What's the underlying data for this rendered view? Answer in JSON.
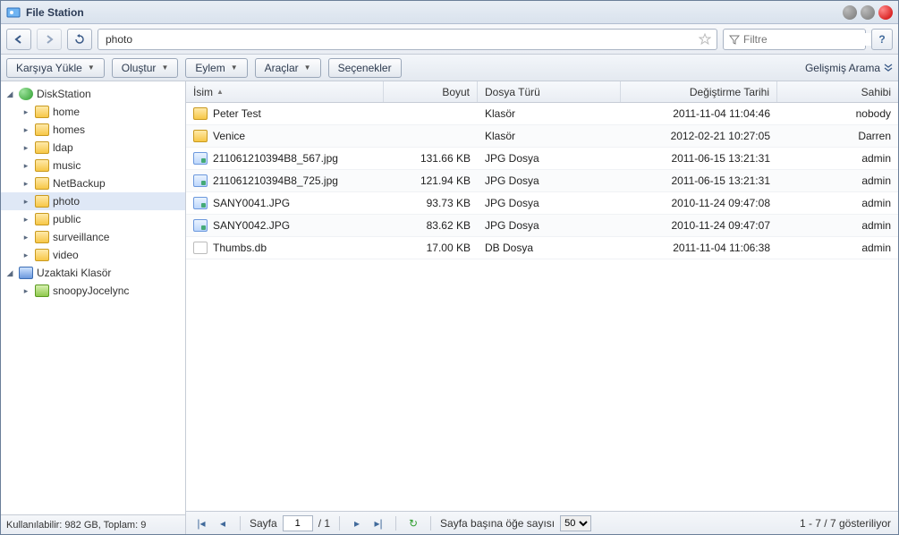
{
  "window": {
    "title": "File Station"
  },
  "nav": {
    "path_value": "photo",
    "filter_placeholder": "Filtre",
    "help_label": "?"
  },
  "toolbar": {
    "upload": "Karşıya Yükle",
    "create": "Oluştur",
    "action": "Eylem",
    "tools": "Araçlar",
    "options": "Seçenekler",
    "advanced_search": "Gelişmiş Arama"
  },
  "sidebar": {
    "root1": "DiskStation",
    "items1": [
      "home",
      "homes",
      "ldap",
      "music",
      "NetBackup",
      "photo",
      "public",
      "surveillance",
      "video"
    ],
    "selected": "photo",
    "root2": "Uzaktaki Klasör",
    "items2": [
      "snoopyJocelync"
    ],
    "status": "Kullanılabilir: 982 GB, Toplam: 9"
  },
  "columns": {
    "name": "İsim",
    "size": "Boyut",
    "type": "Dosya Türü",
    "modified": "Değiştirme Tarihi",
    "owner": "Sahibi"
  },
  "rows": [
    {
      "icon": "folder",
      "name": "Peter Test",
      "size": "",
      "type": "Klasör",
      "date": "2011-11-04 11:04:46",
      "owner": "nobody"
    },
    {
      "icon": "folder",
      "name": "Venice",
      "size": "",
      "type": "Klasör",
      "date": "2012-02-21 10:27:05",
      "owner": "Darren"
    },
    {
      "icon": "jpg",
      "name": "211061210394B8_567.jpg",
      "size": "131.66 KB",
      "type": "JPG Dosya",
      "date": "2011-06-15 13:21:31",
      "owner": "admin"
    },
    {
      "icon": "jpg",
      "name": "211061210394B8_725.jpg",
      "size": "121.94 KB",
      "type": "JPG Dosya",
      "date": "2011-06-15 13:21:31",
      "owner": "admin"
    },
    {
      "icon": "jpg",
      "name": "SANY0041.JPG",
      "size": "93.73 KB",
      "type": "JPG Dosya",
      "date": "2010-11-24 09:47:08",
      "owner": "admin"
    },
    {
      "icon": "jpg",
      "name": "SANY0042.JPG",
      "size": "83.62 KB",
      "type": "JPG Dosya",
      "date": "2010-11-24 09:47:07",
      "owner": "admin"
    },
    {
      "icon": "db",
      "name": "Thumbs.db",
      "size": "17.00 KB",
      "type": "DB Dosya",
      "date": "2011-11-04 11:06:38",
      "owner": "admin"
    }
  ],
  "pager": {
    "page_label": "Sayfa",
    "page_value": "1",
    "page_total": "/ 1",
    "per_page_label": "Sayfa başına öğe sayısı",
    "per_page_value": "50",
    "showing": "1 - 7 / 7 gösteriliyor"
  }
}
